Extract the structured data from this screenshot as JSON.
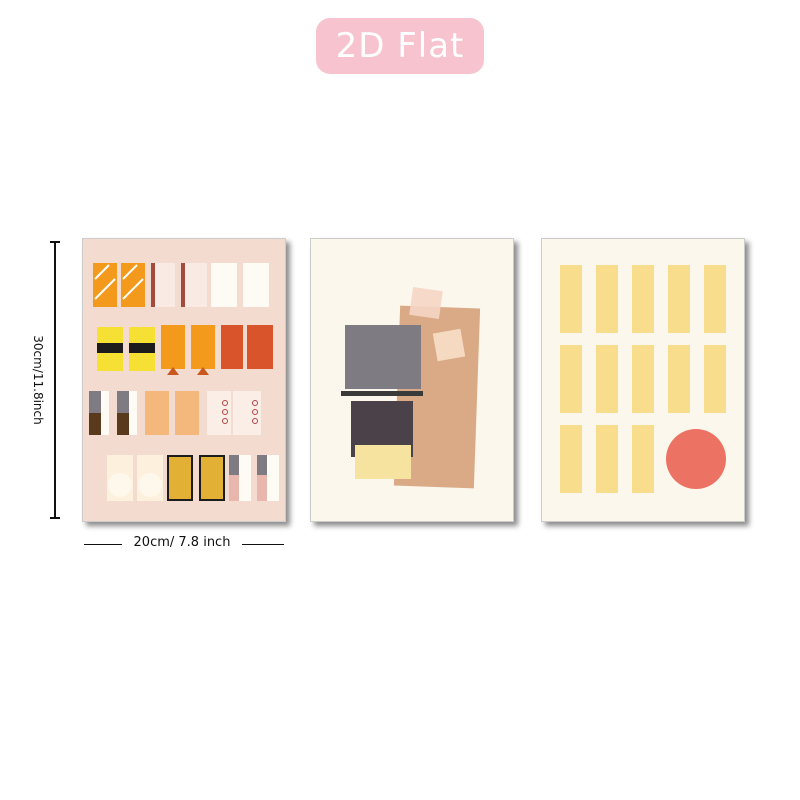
{
  "badge": {
    "label": "2D Flat"
  },
  "dimensions": {
    "height_label": "30cm/11.8inch",
    "width_label": "20cm/ 7.8 inch"
  },
  "colors": {
    "badge_bg": "#f7c3cf",
    "poster1_bg": "#f3dccf",
    "poster_bg": "#fbf7ec",
    "orange": "#f39a1d",
    "yellow": "#f6e034",
    "yellow_soft": "#f7dd8c",
    "coral": "#ec7263",
    "grey": "#7e7c82",
    "tan": "#d9aa85"
  }
}
